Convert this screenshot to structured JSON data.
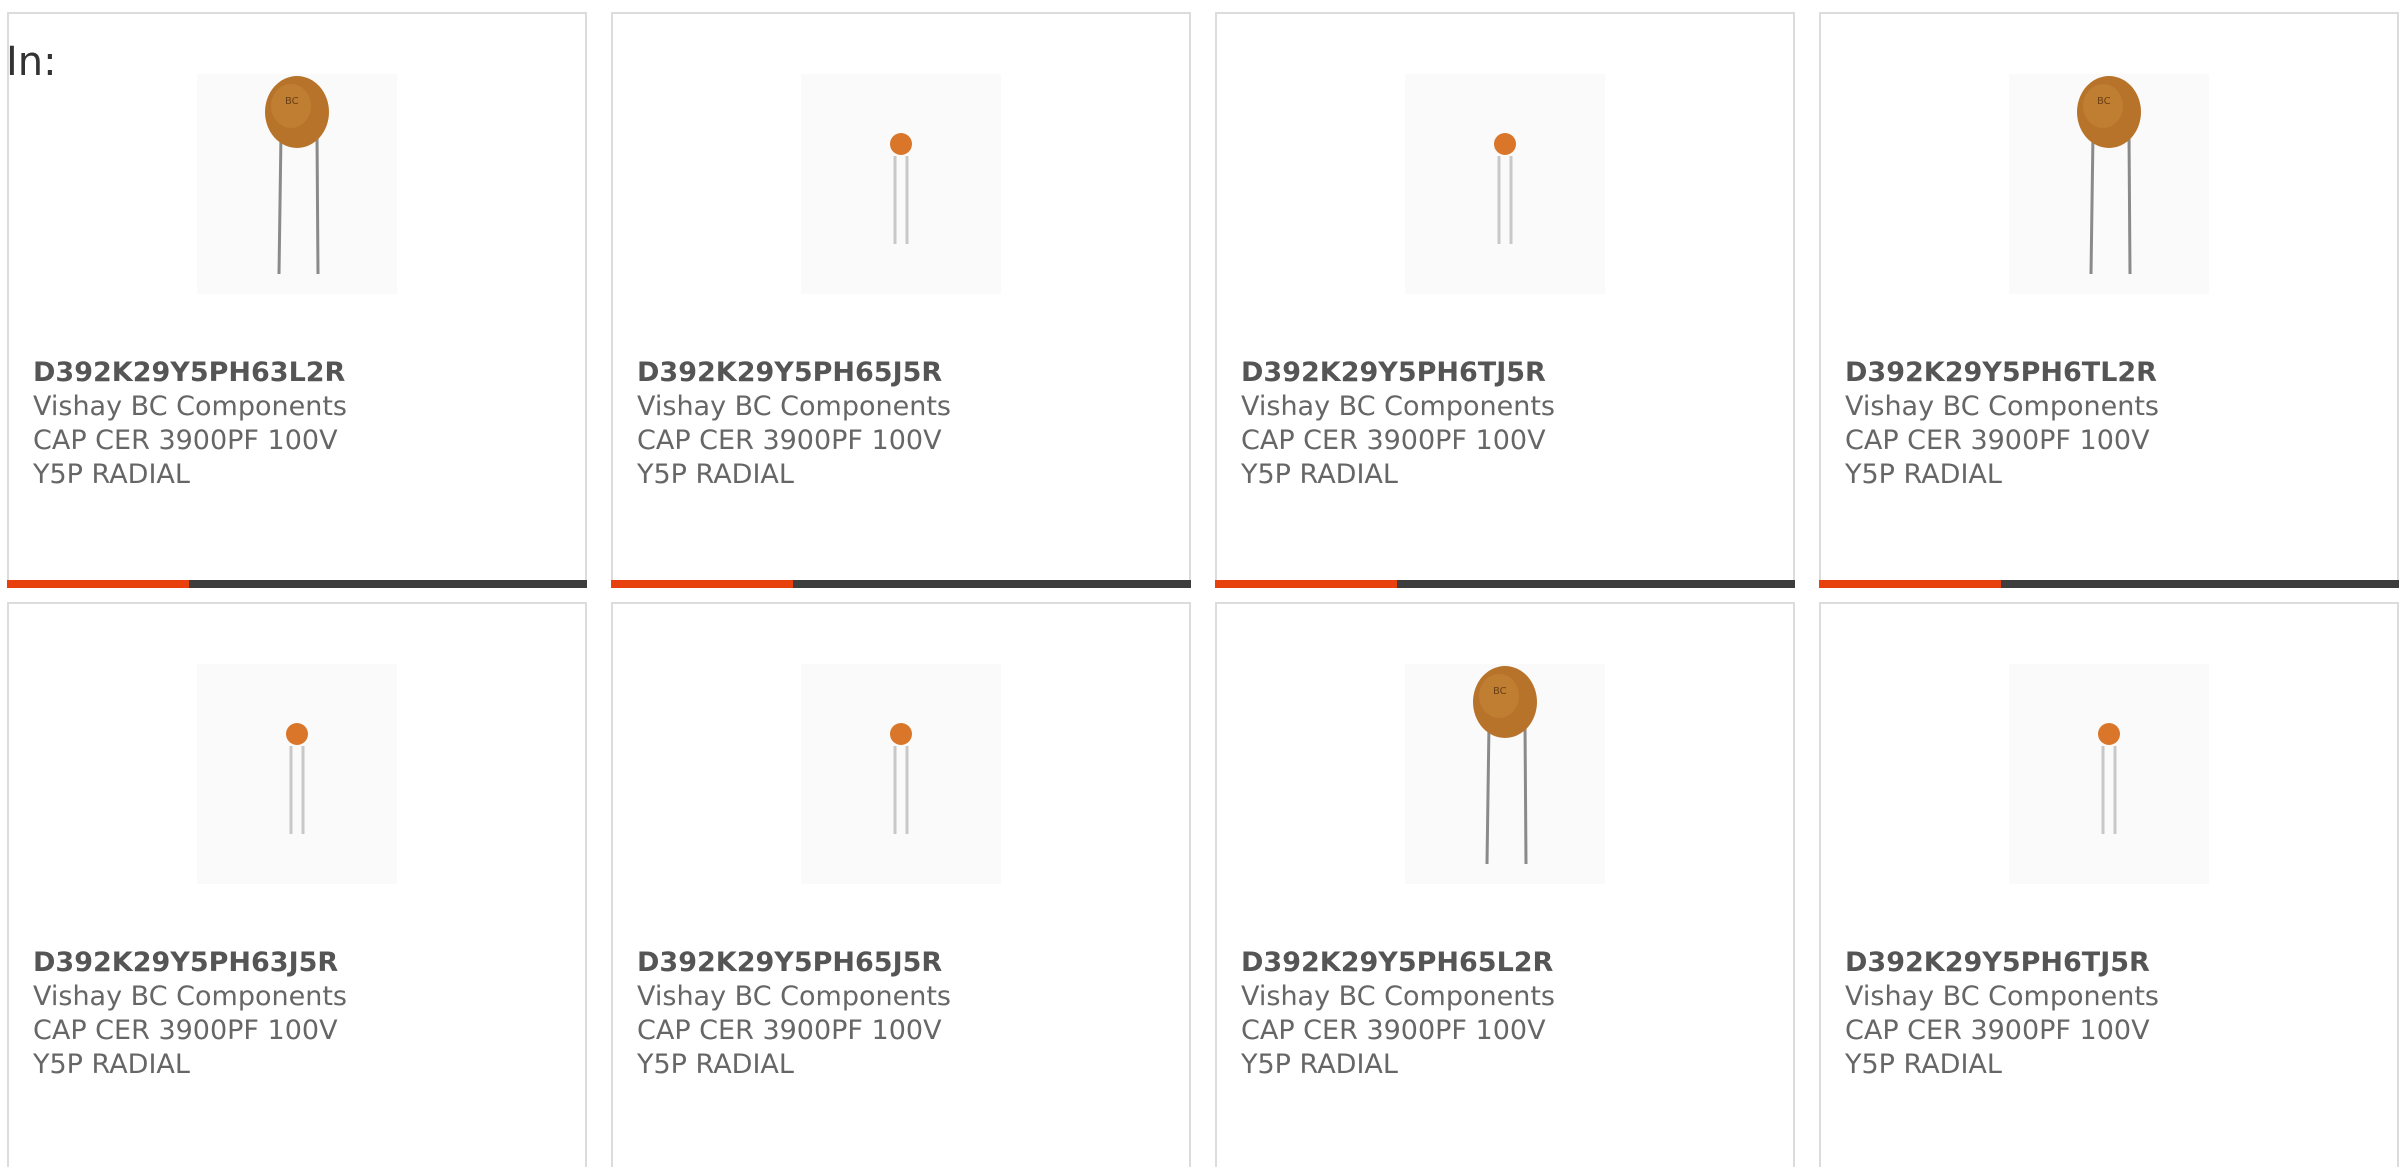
{
  "filter": {
    "label": "In:"
  },
  "colors": {
    "accent": "#e8400c",
    "bar": "#3d3d3d",
    "capacitor_body": "#c07a2a",
    "capacitor_small": "#d9762a"
  },
  "products": [
    {
      "part_number": "D392K29Y5PH63L2R",
      "manufacturer": "Vishay BC Components",
      "description": "CAP CER 3900PF 100V Y5P RADIAL",
      "image": "large-disc-capacitor-icon"
    },
    {
      "part_number": "D392K29Y5PH65J5R",
      "manufacturer": "Vishay BC Components",
      "description": "CAP CER 3900PF 100V Y5P RADIAL",
      "image": "small-disc-capacitor-icon"
    },
    {
      "part_number": "D392K29Y5PH6TJ5R",
      "manufacturer": "Vishay BC Components",
      "description": "CAP CER 3900PF 100V Y5P RADIAL",
      "image": "small-disc-capacitor-icon"
    },
    {
      "part_number": "D392K29Y5PH6TL2R",
      "manufacturer": "Vishay BC Components",
      "description": "CAP CER 3900PF 100V Y5P RADIAL",
      "image": "large-disc-capacitor-icon"
    },
    {
      "part_number": "D392K29Y5PH63J5R",
      "manufacturer": "Vishay BC Components",
      "description": "CAP CER 3900PF 100V Y5P RADIAL",
      "image": "small-disc-capacitor-icon"
    },
    {
      "part_number": "D392K29Y5PH65J5R",
      "manufacturer": "Vishay BC Components",
      "description": "CAP CER 3900PF 100V Y5P RADIAL",
      "image": "small-disc-capacitor-icon"
    },
    {
      "part_number": "D392K29Y5PH65L2R",
      "manufacturer": "Vishay BC Components",
      "description": "CAP CER 3900PF 100V Y5P RADIAL",
      "image": "large-disc-capacitor-icon"
    },
    {
      "part_number": "D392K29Y5PH6TJ5R",
      "manufacturer": "Vishay BC Components",
      "description": "CAP CER 3900PF 100V Y5P RADIAL",
      "image": "small-disc-capacitor-icon"
    }
  ]
}
